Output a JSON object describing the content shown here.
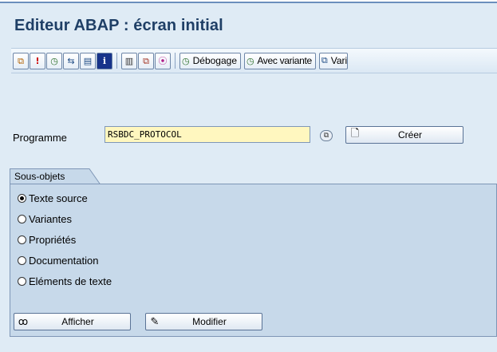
{
  "title": "Editeur ABAP : écran initial",
  "toolbar": {
    "icon_buttons_1": [
      {
        "icon": "object-list-icon",
        "glyph": "⧉"
      },
      {
        "icon": "info-exclamation-icon",
        "glyph": "!"
      },
      {
        "icon": "execute-clock-icon",
        "glyph": "◷"
      },
      {
        "icon": "where-used-icon",
        "glyph": "⇆"
      },
      {
        "icon": "display-object-icon",
        "glyph": "▤"
      },
      {
        "icon": "information-icon",
        "glyph": "i"
      }
    ],
    "icon_buttons_2": [
      {
        "icon": "delete-icon",
        "glyph": "🗑"
      },
      {
        "icon": "copy-icon",
        "glyph": "⧉"
      },
      {
        "icon": "check-icon",
        "glyph": "⦿"
      }
    ],
    "debug_label": "Débogage",
    "variant_label": "Avec variante",
    "vari_label": "Vari"
  },
  "program": {
    "label": "Programme",
    "value": "RSBDC_PROTOCOL",
    "create_label": "Créer"
  },
  "subobjects": {
    "title": "Sous-objets",
    "options": [
      {
        "label": "Texte source",
        "selected": true
      },
      {
        "label": "Variantes",
        "selected": false
      },
      {
        "label": "Propriétés",
        "selected": false
      },
      {
        "label": "Documentation",
        "selected": false
      },
      {
        "label": "Eléments de texte",
        "selected": false
      }
    ]
  },
  "actions": {
    "display_label": "Afficher",
    "change_label": "Modifier"
  },
  "colors": {
    "background": "#dfebf5",
    "title": "#1f3f66",
    "input_bg": "#fff7bf",
    "group_bg": "#c7d9ea"
  }
}
